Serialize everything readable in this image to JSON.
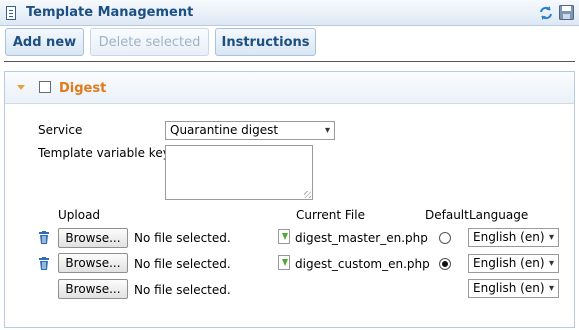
{
  "window": {
    "title": "Template Management"
  },
  "toolbar": {
    "add_new": "Add new",
    "delete_selected": "Delete selected",
    "instructions": "Instructions"
  },
  "section": {
    "title": "Digest",
    "service_label": "Service",
    "service_value": "Quarantine digest",
    "variable_keys_label": "Template variable keys",
    "variable_keys_value": ""
  },
  "files": {
    "headers": {
      "upload": "Upload",
      "current_file": "Current File",
      "default": "Default",
      "language": "Language"
    },
    "browse_label": "Browse...",
    "rows": [
      {
        "status": "No file selected.",
        "current_file": "digest_master_en.php",
        "default": false,
        "language": "English (en)"
      },
      {
        "status": "No file selected.",
        "current_file": "digest_custom_en.php",
        "default": true,
        "language": "English (en)"
      },
      {
        "status": "No file selected.",
        "current_file": "",
        "default": false,
        "language": "English (en)"
      }
    ]
  },
  "colors": {
    "title": "#1c4f82",
    "section_title": "#e07a1a",
    "icon_green": "#4caf2a",
    "trash_blue": "#2f6db5"
  },
  "icons": [
    "window-icon",
    "refresh-icon",
    "save-icon",
    "collapse-arrow-icon",
    "trash-icon",
    "file-download-icon"
  ]
}
